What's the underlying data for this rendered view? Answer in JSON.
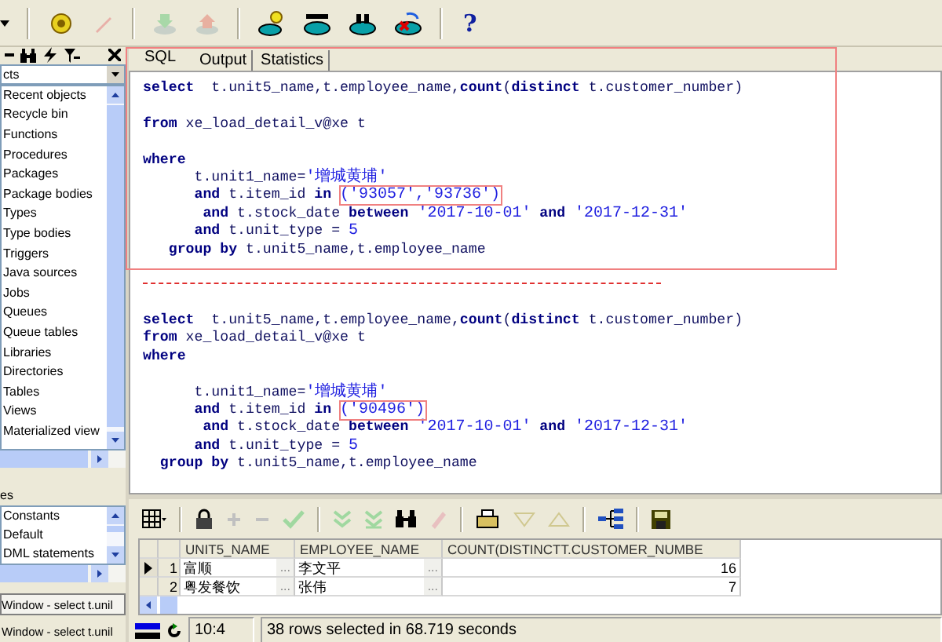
{
  "toolbar": {
    "help_label": "?"
  },
  "browser": {
    "filter": "cts",
    "items": [
      "Recent objects",
      "Recycle bin",
      "Functions",
      "Procedures",
      "Packages",
      "Package bodies",
      "Types",
      "Type bodies",
      "Triggers",
      "Java sources",
      "Jobs",
      "Queues",
      "Queue tables",
      "Libraries",
      "Directories",
      "Tables",
      "Views",
      "Materialized view"
    ]
  },
  "templates": {
    "title": "es",
    "items": [
      "Constants",
      "Default",
      "DML statements"
    ]
  },
  "windows": [
    {
      "label": "Window - select t.unil",
      "selected": true
    },
    {
      "label": "Window - select t.unil",
      "selected": false
    }
  ],
  "tabs": [
    {
      "label": "SQL",
      "selected": true
    },
    {
      "label": "Output",
      "selected": false
    },
    {
      "label": "Statistics",
      "selected": false
    }
  ],
  "code": [
    {
      "kind": "code",
      "segments": [
        {
          "kind": "keyword",
          "text": "select"
        },
        {
          "kind": "plain",
          "text": "  t.unit5_name,t.employee_name,"
        },
        {
          "kind": "keyword",
          "text": "count"
        },
        {
          "kind": "plain",
          "text": "("
        },
        {
          "kind": "keyword",
          "text": "distinct"
        },
        {
          "kind": "plain",
          "text": " t.customer_number)"
        }
      ]
    },
    {
      "kind": "blank"
    },
    {
      "kind": "code",
      "segments": [
        {
          "kind": "keyword",
          "text": "from"
        },
        {
          "kind": "plain",
          "text": " xe_load_detail_v@xe t"
        }
      ]
    },
    {
      "kind": "blank"
    },
    {
      "kind": "code",
      "segments": [
        {
          "kind": "keyword",
          "text": "where"
        }
      ]
    },
    {
      "kind": "code",
      "segments": [
        {
          "kind": "plain",
          "text": "      t.unit1_name="
        },
        {
          "kind": "string",
          "text": "'增城黄埔'"
        }
      ]
    },
    {
      "kind": "code",
      "segments": [
        {
          "kind": "keyword",
          "text": "      and",
          "highlighted": false
        },
        {
          "kind": "plain",
          "text": " t.item_id ",
          "highlighted": false
        },
        {
          "kind": "keyword",
          "text": "in ",
          "highlighted": false
        },
        {
          "kind": "string",
          "text": "('93057','93736')",
          "highlighted": true
        }
      ]
    },
    {
      "kind": "code",
      "segments": [
        {
          "kind": "keyword",
          "text": "       and"
        },
        {
          "kind": "plain",
          "text": " t.stock_date "
        },
        {
          "kind": "keyword",
          "text": "between"
        },
        {
          "kind": "string",
          "text": " '2017-10-01'"
        },
        {
          "kind": "keyword",
          "text": " and"
        },
        {
          "kind": "string",
          "text": " '2017-12-31'"
        }
      ]
    },
    {
      "kind": "code",
      "segments": [
        {
          "kind": "keyword",
          "text": "      and"
        },
        {
          "kind": "plain",
          "text": " t.unit_type = "
        },
        {
          "kind": "string",
          "text": "5"
        }
      ]
    },
    {
      "kind": "code",
      "segments": [
        {
          "kind": "keyword",
          "text": "   group by"
        },
        {
          "kind": "plain",
          "text": " t.unit5_name,t.employee_name"
        }
      ]
    },
    {
      "kind": "blank"
    },
    {
      "kind": "separator"
    },
    {
      "kind": "blank"
    },
    {
      "kind": "code",
      "segments": [
        {
          "kind": "keyword",
          "text": "select"
        },
        {
          "kind": "plain",
          "text": "  t.unit5_name,t.employee_name,"
        },
        {
          "kind": "keyword",
          "text": "count"
        },
        {
          "kind": "plain",
          "text": "("
        },
        {
          "kind": "keyword",
          "text": "distinct"
        },
        {
          "kind": "plain",
          "text": " t.customer_number)"
        }
      ]
    },
    {
      "kind": "code",
      "segments": [
        {
          "kind": "keyword",
          "text": "from"
        },
        {
          "kind": "plain",
          "text": " xe_load_detail_v@xe t"
        }
      ]
    },
    {
      "kind": "code",
      "segments": [
        {
          "kind": "keyword",
          "text": "where"
        }
      ]
    },
    {
      "kind": "blank"
    },
    {
      "kind": "code",
      "segments": [
        {
          "kind": "plain",
          "text": "      t.unit1_name="
        },
        {
          "kind": "string",
          "text": "'增城黄埔'"
        }
      ]
    },
    {
      "kind": "code",
      "segments": [
        {
          "kind": "keyword",
          "text": "      and",
          "highlighted": false
        },
        {
          "kind": "plain",
          "text": " t.item_id ",
          "highlighted": false
        },
        {
          "kind": "keyword",
          "text": "in ",
          "highlighted": false
        },
        {
          "kind": "string",
          "text": "('90496')",
          "highlighted": true
        }
      ]
    },
    {
      "kind": "code",
      "segments": [
        {
          "kind": "keyword",
          "text": "       and"
        },
        {
          "kind": "plain",
          "text": " t.stock_date "
        },
        {
          "kind": "keyword",
          "text": "between"
        },
        {
          "kind": "string",
          "text": " '2017-10-01'"
        },
        {
          "kind": "keyword",
          "text": " and"
        },
        {
          "kind": "string",
          "text": " '2017-12-31'"
        }
      ]
    },
    {
      "kind": "code",
      "segments": [
        {
          "kind": "keyword",
          "text": "      and"
        },
        {
          "kind": "plain",
          "text": " t.unit_type = "
        },
        {
          "kind": "string",
          "text": "5"
        }
      ]
    },
    {
      "kind": "code",
      "segments": [
        {
          "kind": "keyword",
          "text": "  group by"
        },
        {
          "kind": "plain",
          "text": " t.unit5_name,t.employee_name"
        }
      ]
    }
  ],
  "grid": {
    "columns": [
      "UNIT5_NAME",
      "EMPLOYEE_NAME",
      "COUNT(DISTINCTT.CUSTOMER_NUMBE"
    ],
    "rows": [
      {
        "number": "1",
        "selected": true,
        "cells": [
          {
            "value": "富顺",
            "button": "..."
          },
          {
            "value": "李文平",
            "button": "..."
          },
          {
            "value": "16"
          }
        ]
      },
      {
        "number": "2",
        "selected": false,
        "cells": [
          {
            "value": "粤发餐饮",
            "button": "..."
          },
          {
            "value": "张伟",
            "button": "..."
          },
          {
            "value": "7"
          }
        ]
      }
    ]
  },
  "status_bar": {
    "position": "10:4",
    "message": "38 rows selected in 68.719 seconds"
  }
}
